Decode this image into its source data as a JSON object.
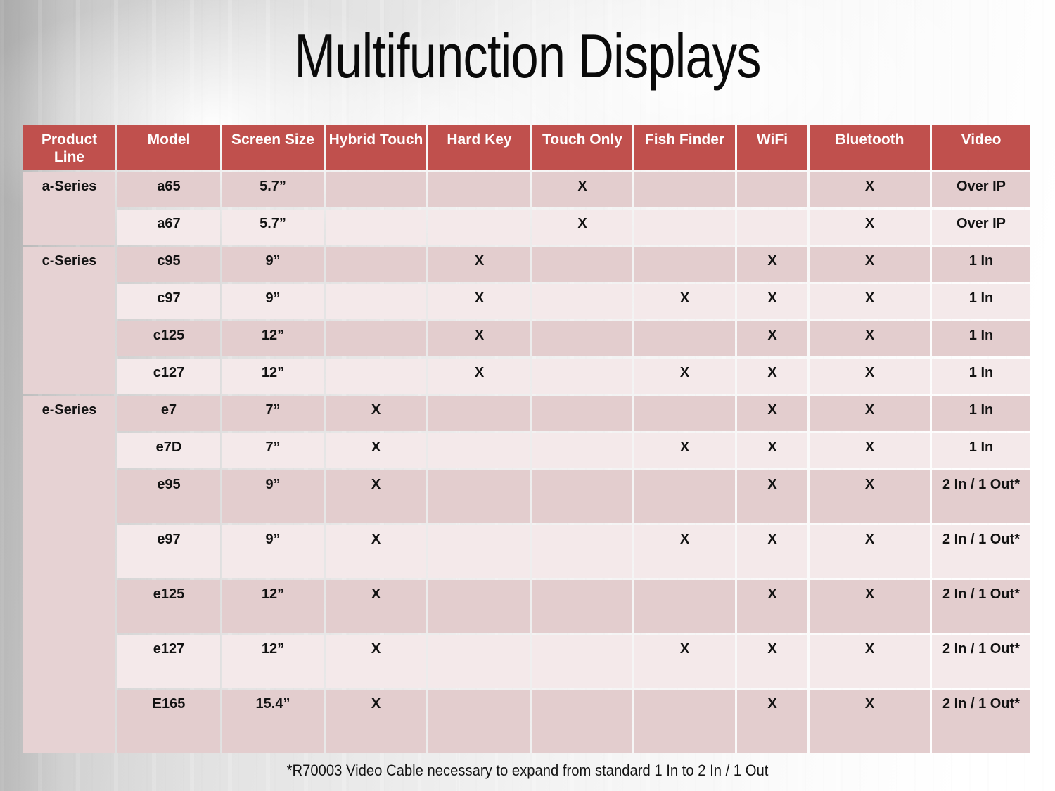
{
  "slide": {
    "title": "Multifunction Displays",
    "footnote": "*R70003 Video Cable necessary to expand from standard 1 In to 2 In / 1 Out",
    "colors": {
      "header_bg": "#C0504D",
      "header_text": "#FFFFFF",
      "row_band_dark": "#E3CDCE",
      "row_band_light": "#F4E9EA",
      "series_cell_bg": "#E6D2D3",
      "body_text": "#121212",
      "background": "#E8E8E8"
    }
  },
  "table": {
    "columns": [
      {
        "key": "product_line",
        "label": "Product Line"
      },
      {
        "key": "model",
        "label": "Model"
      },
      {
        "key": "screen_size",
        "label": "Screen Size"
      },
      {
        "key": "hybrid_touch",
        "label": "Hybrid Touch"
      },
      {
        "key": "hard_key",
        "label": "Hard Key"
      },
      {
        "key": "touch_only",
        "label": "Touch Only"
      },
      {
        "key": "fish_finder",
        "label": "Fish Finder"
      },
      {
        "key": "wifi",
        "label": "WiFi"
      },
      {
        "key": "bluetooth",
        "label": "Bluetooth"
      },
      {
        "key": "video",
        "label": "Video"
      }
    ],
    "mark": "X",
    "groups": [
      {
        "series": "a-Series",
        "rows": [
          {
            "model": "a65",
            "screen_size": "5.7”",
            "hybrid_touch": "",
            "hard_key": "",
            "touch_only": "X",
            "fish_finder": "",
            "wifi": "",
            "bluetooth": "X",
            "video": "Over IP"
          },
          {
            "model": "a67",
            "screen_size": "5.7”",
            "hybrid_touch": "",
            "hard_key": "",
            "touch_only": "X",
            "fish_finder": "",
            "wifi": "",
            "bluetooth": "X",
            "video": "Over IP"
          }
        ]
      },
      {
        "series": "c-Series",
        "rows": [
          {
            "model": "c95",
            "screen_size": "9”",
            "hybrid_touch": "",
            "hard_key": "X",
            "touch_only": "",
            "fish_finder": "",
            "wifi": "X",
            "bluetooth": "X",
            "video": "1 In"
          },
          {
            "model": "c97",
            "screen_size": "9”",
            "hybrid_touch": "",
            "hard_key": "X",
            "touch_only": "",
            "fish_finder": "X",
            "wifi": "X",
            "bluetooth": "X",
            "video": "1 In"
          },
          {
            "model": "c125",
            "screen_size": "12”",
            "hybrid_touch": "",
            "hard_key": "X",
            "touch_only": "",
            "fish_finder": "",
            "wifi": "X",
            "bluetooth": "X",
            "video": "1 In"
          },
          {
            "model": "c127",
            "screen_size": "12”",
            "hybrid_touch": "",
            "hard_key": "X",
            "touch_only": "",
            "fish_finder": "X",
            "wifi": "X",
            "bluetooth": "X",
            "video": "1 In"
          }
        ]
      },
      {
        "series": "e-Series",
        "rows": [
          {
            "model": "e7",
            "screen_size": "7”",
            "hybrid_touch": "X",
            "hard_key": "",
            "touch_only": "",
            "fish_finder": "",
            "wifi": "X",
            "bluetooth": "X",
            "video": "1 In"
          },
          {
            "model": "e7D",
            "screen_size": "7”",
            "hybrid_touch": "X",
            "hard_key": "",
            "touch_only": "",
            "fish_finder": "X",
            "wifi": "X",
            "bluetooth": "X",
            "video": "1 In"
          },
          {
            "model": "e95",
            "screen_size": "9”",
            "hybrid_touch": "X",
            "hard_key": "",
            "touch_only": "",
            "fish_finder": "",
            "wifi": "X",
            "bluetooth": "X",
            "video": "2 In / 1 Out*"
          },
          {
            "model": "e97",
            "screen_size": "9”",
            "hybrid_touch": "X",
            "hard_key": "",
            "touch_only": "",
            "fish_finder": "X",
            "wifi": "X",
            "bluetooth": "X",
            "video": "2 In / 1 Out*"
          },
          {
            "model": "e125",
            "screen_size": "12”",
            "hybrid_touch": "X",
            "hard_key": "",
            "touch_only": "",
            "fish_finder": "",
            "wifi": "X",
            "bluetooth": "X",
            "video": "2 In / 1 Out*"
          },
          {
            "model": "e127",
            "screen_size": "12”",
            "hybrid_touch": "X",
            "hard_key": "",
            "touch_only": "",
            "fish_finder": "X",
            "wifi": "X",
            "bluetooth": "X",
            "video": "2 In / 1 Out*"
          },
          {
            "model": "E165",
            "screen_size": "15.4”",
            "hybrid_touch": "X",
            "hard_key": "",
            "touch_only": "",
            "fish_finder": "",
            "wifi": "X",
            "bluetooth": "X",
            "video": "2 In / 1 Out*"
          }
        ]
      }
    ],
    "row_heights": {
      "a65": 50,
      "a67": 50,
      "c95": 50,
      "c97": 50,
      "c125": 50,
      "c127": 50,
      "e7": 50,
      "e7D": 50,
      "e95": 75,
      "e97": 75,
      "e125": 75,
      "e127": 75,
      "E165": 90
    }
  }
}
